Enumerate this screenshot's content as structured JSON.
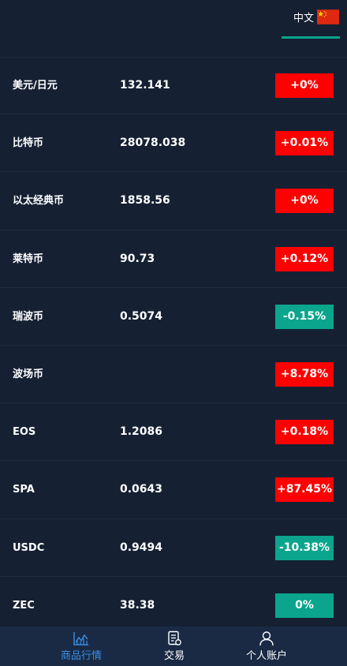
{
  "header": {
    "language_label": "中文",
    "flag_icon": "china-flag-icon"
  },
  "rows": [
    {
      "name": "美元/日元",
      "price": "132.141",
      "change": "+0%",
      "trend": "up"
    },
    {
      "name": "比特币",
      "price": "28078.038",
      "change": "+0.01%",
      "trend": "up"
    },
    {
      "name": "以太经典币",
      "price": "1858.56",
      "change": "+0%",
      "trend": "up"
    },
    {
      "name": "莱特币",
      "price": "90.73",
      "change": "+0.12%",
      "trend": "up"
    },
    {
      "name": "瑞波币",
      "price": "0.5074",
      "change": "-0.15%",
      "trend": "down"
    },
    {
      "name": "波场币",
      "price": "",
      "change": "+8.78%",
      "trend": "up"
    },
    {
      "name": "EOS",
      "price": "1.2086",
      "change": "+0.18%",
      "trend": "up"
    },
    {
      "name": "SPA",
      "price": "0.0643",
      "change": "+87.45%",
      "trend": "up"
    },
    {
      "name": "USDC",
      "price": "0.9494",
      "change": "-10.38%",
      "trend": "down"
    },
    {
      "name": "ZEC",
      "price": "38.38",
      "change": "0%",
      "trend": "down"
    }
  ],
  "colors": {
    "background": "#152033",
    "up": "#ff0000",
    "down": "#0aa58c",
    "tab_active": "#3a8fe6"
  },
  "tabbar": {
    "tabs": [
      {
        "label": "商品行情",
        "icon": "market-chart-icon",
        "active": true
      },
      {
        "label": "交易",
        "icon": "trade-document-icon",
        "active": false
      },
      {
        "label": "个人账户",
        "icon": "user-account-icon",
        "active": false
      }
    ]
  }
}
